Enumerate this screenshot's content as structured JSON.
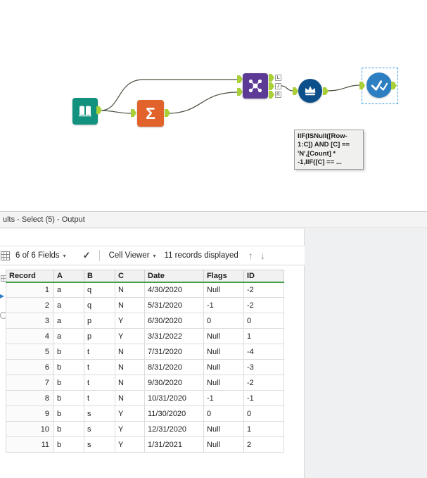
{
  "icons": {
    "sigma": "Σ",
    "caret_down": "▾",
    "check": "✓",
    "arrow_up": "↑",
    "arrow_down": "↓",
    "gutter_arrow": "▸"
  },
  "canvas": {
    "tooltip_text": "IIF(ISNull([Row-1:C]) AND [C] == 'N',[Count] * -1,IIF([C] == ...",
    "join_anchor_labels": {
      "out_l": "L",
      "out_j": "J",
      "out_r": "R"
    }
  },
  "results": {
    "title": "ults - Select (5) - Output",
    "toolbar": {
      "fields_selector": "6 of 6 Fields",
      "cell_viewer": "Cell Viewer",
      "records_displayed": "11 records displayed"
    },
    "table": {
      "columns": [
        "Record",
        "A",
        "B",
        "C",
        "Date",
        "Flags",
        "ID"
      ],
      "rows": [
        [
          "1",
          "a",
          "q",
          "N",
          "4/30/2020",
          "Null",
          "-2"
        ],
        [
          "2",
          "a",
          "q",
          "N",
          "5/31/2020",
          "-1",
          "-2"
        ],
        [
          "3",
          "a",
          "p",
          "Y",
          "6/30/2020",
          "0",
          "0"
        ],
        [
          "4",
          "a",
          "p",
          "Y",
          "3/31/2022",
          "Null",
          "1"
        ],
        [
          "5",
          "b",
          "t",
          "N",
          "7/31/2020",
          "Null",
          "-4"
        ],
        [
          "6",
          "b",
          "t",
          "N",
          "8/31/2020",
          "Null",
          "-3"
        ],
        [
          "7",
          "b",
          "t",
          "N",
          "9/30/2020",
          "Null",
          "-2"
        ],
        [
          "8",
          "b",
          "t",
          "N",
          "10/31/2020",
          "-1",
          "-1"
        ],
        [
          "9",
          "b",
          "s",
          "Y",
          "11/30/2020",
          "0",
          "0"
        ],
        [
          "10",
          "b",
          "s",
          "Y",
          "12/31/2020",
          "Null",
          "1"
        ],
        [
          "11",
          "b",
          "s",
          "Y",
          "1/31/2021",
          "Null",
          "2"
        ]
      ]
    }
  }
}
